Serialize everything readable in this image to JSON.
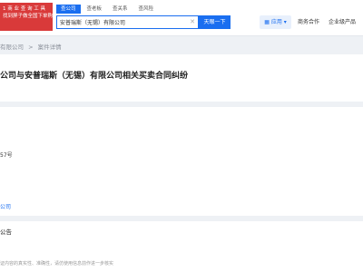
{
  "logo": {
    "line1": "1 商 业 查 询 工 具",
    "line2": "找到屏子做全国下单购"
  },
  "search": {
    "tabs": [
      {
        "label": "查公司",
        "active": true
      },
      {
        "label": "查老板",
        "active": false
      },
      {
        "label": "查关系",
        "active": false
      },
      {
        "label": "查风险",
        "active": false
      }
    ],
    "value": "安普瑞斯（无锡）有限公司",
    "button_label": "天眼一下"
  },
  "nav": {
    "app_label": "应用",
    "business_label": "商务合作",
    "enterprise_label": "企业级产品"
  },
  "breadcrumb": {
    "company": "有限公司",
    "current": "案件详情"
  },
  "case": {
    "title": "公司与安普瑞斯（无锡）有限公司相关买卖合同纠纷",
    "case_no_fragment": "57号",
    "party_link": "公司",
    "section_label": "公告"
  },
  "footer": {
    "disclaimer": "证内容的真实性、准确性，请仿使用信息前作进一步核实"
  },
  "colors": {
    "brand_blue": "#1a6ef0",
    "logo_red": "#d93a3a"
  }
}
